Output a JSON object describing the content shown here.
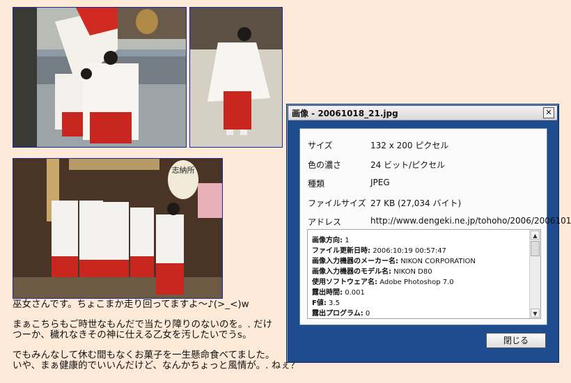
{
  "dialog": {
    "title": "画像 - 20061018_21.jpg",
    "close_glyph": "✕",
    "rows": [
      {
        "label": "サイズ",
        "value": "132 x 200 ピクセル"
      },
      {
        "label": "色の濃さ",
        "value": "24 ビット/ピクセル"
      },
      {
        "label": "種類",
        "value": "JPEG"
      },
      {
        "label": "ファイルサイズ",
        "value": "27 KB (27,034 バイト)"
      },
      {
        "label": "アドレス",
        "value": "http://www.dengeki.ne.jp/tohoho/2006/2006101"
      }
    ],
    "exif": [
      {
        "key": "画像方向:",
        "value": "1"
      },
      {
        "key": "ファイル更新日時:",
        "value": "2006:10:19 00:57:47"
      },
      {
        "key": "画像入力機器のメーカー名:",
        "value": "NIKON CORPORATION"
      },
      {
        "key": "画像入力機器のモデル名:",
        "value": "NIKON D80"
      },
      {
        "key": "使用ソフトウェア名:",
        "value": "Adobe Photoshop 7.0"
      },
      {
        "key": "露出時間:",
        "value": "0.001"
      },
      {
        "key": "F値:",
        "value": "3.5"
      },
      {
        "key": "露出プログラム:",
        "value": "0"
      }
    ],
    "close_button_label": "閉じる"
  },
  "blog": {
    "line1": "巫女さんです。ちょこまか走り回ってますよ～♪(>_<)w",
    "line2": "まぁこちらもご時世なもんだで当たり障りのないのを。. だけ",
    "line3": "つーか、穢れなきその神に仕える乙女を汚したいでうs。",
    "line4": "でもみんなして休む間もなくお菓子を一生懸命食べてました。",
    "line5": "いや、まぁ健康的でいいんだけど、なんかちょっと風情が。. ねぇ？"
  },
  "photo3_sign": "志納所",
  "colors": {
    "page_bg": "#fce9d8",
    "photo_border": "#1a2a9a",
    "dialog_frame": "#1e4c8f",
    "miko_red": "#c8261e"
  }
}
